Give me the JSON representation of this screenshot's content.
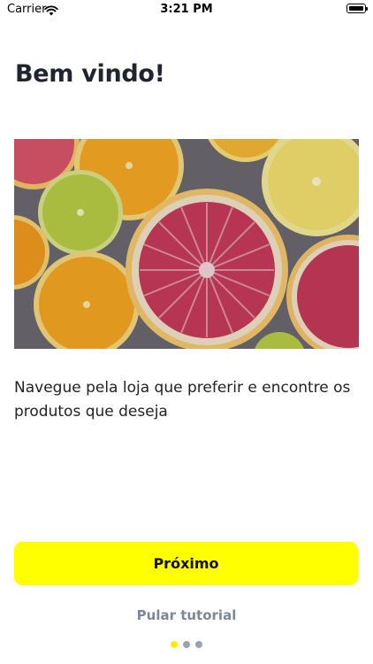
{
  "status_bar": {
    "carrier": "Carrier",
    "time": "3:21 PM"
  },
  "onboarding": {
    "title": "Bem vindo!",
    "description": "Navegue pela loja que preferir e encontre os produtos que deseja",
    "next_label": "Próximo",
    "skip_label": "Pular tutorial",
    "page_count": 3,
    "current_page": 1
  },
  "hero_image": {
    "subject": "halved citrus fruits (grapefruit, orange, lemon, lime)"
  },
  "colors": {
    "accent": "#ffff00",
    "active_dot": "#ffee00",
    "inactive_dot": "#9aa3b0",
    "title": "#1f2430",
    "skip": "#7d8797"
  }
}
